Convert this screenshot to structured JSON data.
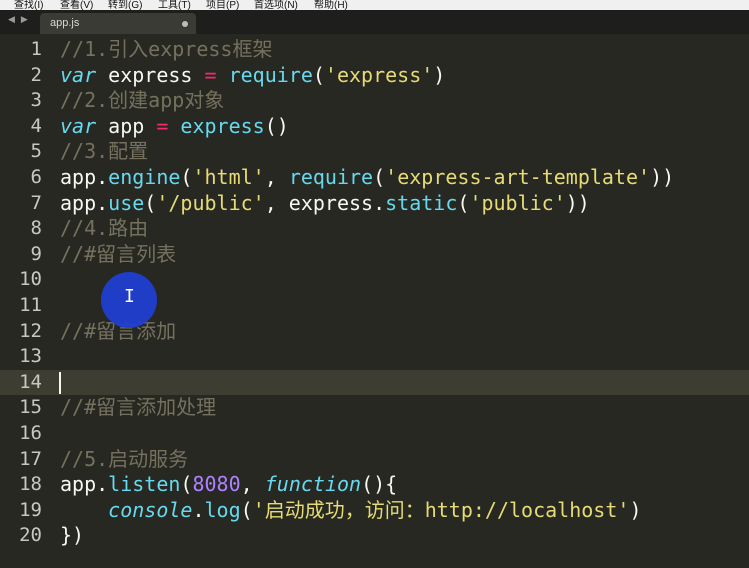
{
  "menubar": {
    "items": [
      "查找(I)",
      "查看(V)",
      "转到(G)",
      "工具(T)",
      "项目(P)",
      "首选项(N)",
      "帮助(H)"
    ]
  },
  "tabs": {
    "nav_prev": "◀",
    "nav_next": "▶",
    "active_file": "app.js",
    "modified_indicator": "dot-icon"
  },
  "editor": {
    "current_line": 14,
    "lines": [
      {
        "num": "1"
      },
      {
        "num": "2"
      },
      {
        "num": "3"
      },
      {
        "num": "4"
      },
      {
        "num": "5"
      },
      {
        "num": "6"
      },
      {
        "num": "7"
      },
      {
        "num": "8"
      },
      {
        "num": "9"
      },
      {
        "num": "10"
      },
      {
        "num": "11"
      },
      {
        "num": "12"
      },
      {
        "num": "13"
      },
      {
        "num": "14"
      },
      {
        "num": "15"
      },
      {
        "num": "16"
      },
      {
        "num": "17"
      },
      {
        "num": "18"
      },
      {
        "num": "19"
      },
      {
        "num": "20"
      }
    ],
    "tokens": {
      "l1": "//1.引入express框架",
      "l2_kw": "var",
      "l2_name": " express ",
      "l2_op": "=",
      "l2_fn": " require",
      "l2_p1": "(",
      "l2_str": "'express'",
      "l2_p2": ")",
      "l3": "//2.创建app对象",
      "l4_kw": "var",
      "l4_name": " app ",
      "l4_op": "=",
      "l4_fn": " express",
      "l4_p": "()",
      "l5": "//3.配置",
      "l6_obj": "app.",
      "l6_fn": "engine",
      "l6_p1": "(",
      "l6_s1": "'html'",
      "l6_c": ", ",
      "l6_fn2": "require",
      "l6_p2": "(",
      "l6_s2": "'express-art-template'",
      "l6_p3": "))",
      "l7_obj": "app.",
      "l7_fn": "use",
      "l7_p1": "(",
      "l7_s1": "'/public'",
      "l7_c": ", express.",
      "l7_fn2": "static",
      "l7_p2": "(",
      "l7_s2": "'public'",
      "l7_p3": "))",
      "l8": "//4.路由",
      "l9": "//#留言列表",
      "l12": "//#留言添加",
      "l15": "//#留言添加处理",
      "l17": "//5.启动服务",
      "l18_obj": "app.",
      "l18_fn": "listen",
      "l18_p1": "(",
      "l18_n": "8080",
      "l18_c": ", ",
      "l18_kw": "function",
      "l18_p2": "(){",
      "l19_ind": "    ",
      "l19_obj": "console",
      "l19_dot": ".",
      "l19_fn": "log",
      "l19_p1": "(",
      "l19_s": "'启动成功，访问：http://localhost'",
      "l19_p2": ")",
      "l20": "})"
    }
  },
  "pointer": {
    "icon": "i-beam-cursor-icon",
    "glyph": "I"
  }
}
